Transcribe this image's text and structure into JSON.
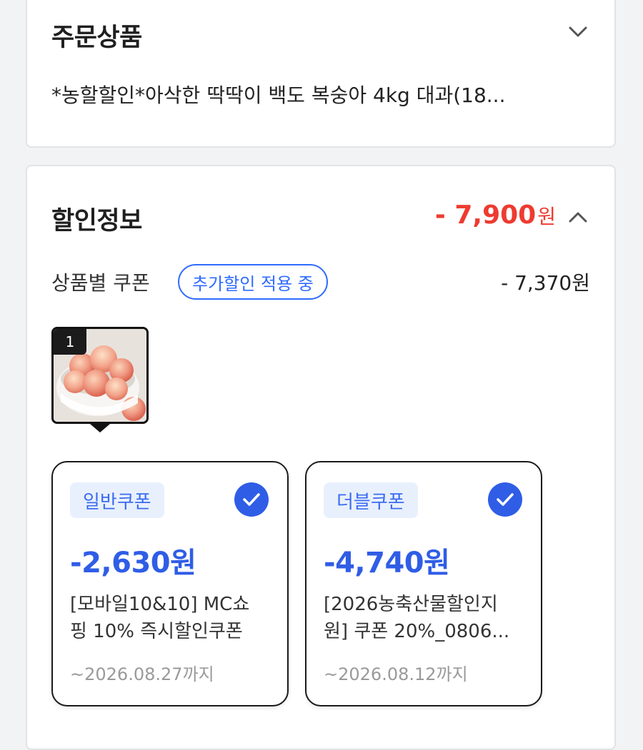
{
  "order": {
    "title": "주문상품",
    "product_name": "*농할할인*아삭한 딱딱이 백도 복숭아 4kg 대과(18..."
  },
  "discount": {
    "title": "할인정보",
    "total_amount": "- 7,900",
    "total_unit": "원",
    "coupon_label": "상품별 쿠폰",
    "badge": "추가할인 적용 중",
    "coupon_amount": "- 7,370원",
    "thumb_index": "1",
    "coupons": [
      {
        "type": "일반쿠폰",
        "amount": "-2,630원",
        "desc_line1": "[모바일10&10] MC쇼",
        "desc_line2": "핑 10% 즉시할인쿠폰",
        "expiry": "~2026.08.27까지",
        "checked": true
      },
      {
        "type": "더블쿠폰",
        "amount": "-4,740원",
        "desc_line1": "[2026농축산물할인지",
        "desc_line2": "원] 쿠폰 20%_0806...",
        "expiry": "~2026.08.12까지",
        "checked": true
      }
    ]
  },
  "colors": {
    "discount_red": "#ee3b30",
    "coupon_blue": "#2f5de6",
    "badge_blue": "#2f6bff"
  },
  "icons": {
    "collapse": "chevron-down-icon",
    "expand": "chevron-up-icon",
    "check": "check-circle-icon"
  }
}
